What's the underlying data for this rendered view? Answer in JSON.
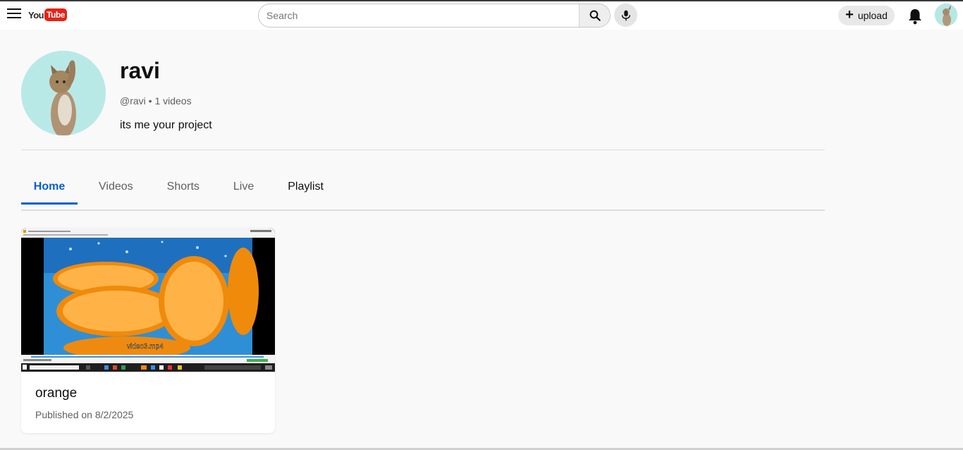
{
  "header": {
    "logo_you": "You",
    "logo_tube": "Tube",
    "search_placeholder": "Search",
    "upload_label": "upload",
    "icons": [
      "menu-icon",
      "search-icon",
      "mic-icon",
      "plus-icon",
      "bell-icon"
    ]
  },
  "channel": {
    "name": "ravi",
    "meta": "@ravi • 1 videos",
    "description": "its me your project"
  },
  "tabs": [
    {
      "label": "Home",
      "active": true
    },
    {
      "label": "Videos",
      "active": false
    },
    {
      "label": "Shorts",
      "active": false
    },
    {
      "label": "Live",
      "active": false
    },
    {
      "label": "Playlist",
      "active": false
    }
  ],
  "videos": [
    {
      "title": "orange",
      "published": "Published on 8/2/2025",
      "thumbnail_caption": "video3.mp4"
    }
  ],
  "colors": {
    "accent": "#065fd4",
    "brand_red": "#e62117",
    "background": "#f9f9f9"
  }
}
